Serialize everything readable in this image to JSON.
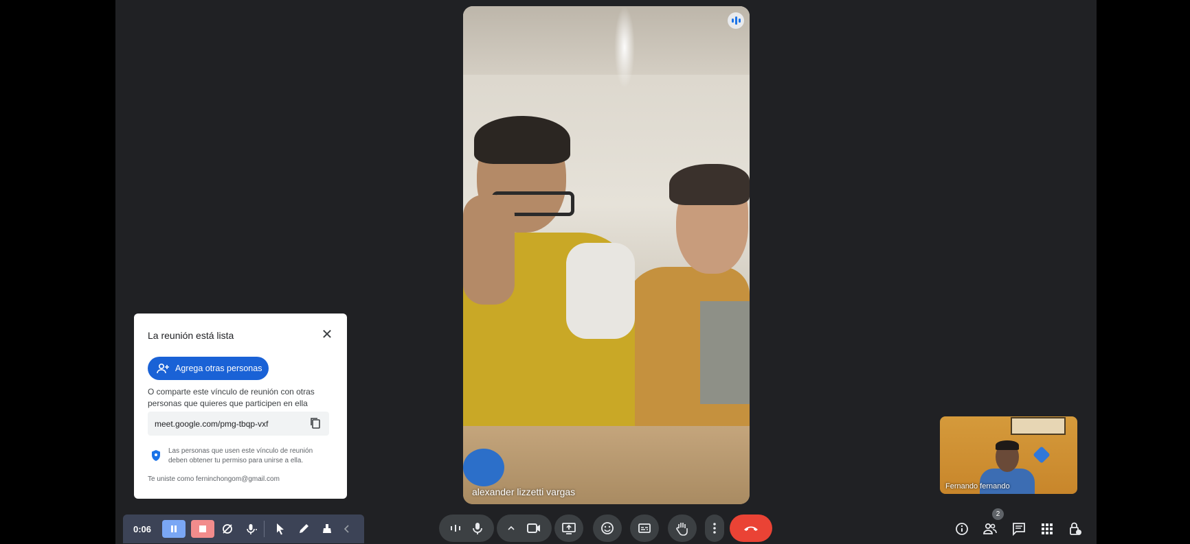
{
  "dialog": {
    "title": "La reunión está lista",
    "add_button_label": "Agrega otras personas",
    "share_text": "O comparte este vínculo de reunión con otras personas que quieres que participen en ella",
    "meeting_link": "meet.google.com/pmg-tbqp-vxf",
    "permission_text": "Las personas que usen este vínculo de reunión deben obtener tu permiso para unirse a ella.",
    "joined_as": "Te uniste como ferninchongom@gmail.com"
  },
  "main_participant": {
    "name": "alexander lizzetti vargas"
  },
  "self_participant": {
    "name": "Fernando fernando"
  },
  "recorder": {
    "timer": "0:06"
  },
  "people": {
    "count": "2"
  },
  "colors": {
    "end_call": "#ea4335",
    "primary_button": "#1a62d6",
    "recorder_bar": "#3c4356"
  },
  "icons": {
    "recorder": [
      "pause-icon",
      "stop-icon",
      "camera-off-icon",
      "mic-icon",
      "pointer-icon",
      "pen-icon",
      "eraser-icon",
      "collapse-chevron-icon"
    ],
    "controls": [
      "audio-levels-icon",
      "mic-icon",
      "chevron-up-icon",
      "camera-icon",
      "present-screen-icon",
      "emoji-icon",
      "captions-icon",
      "raise-hand-icon",
      "more-options-icon",
      "end-call-icon"
    ],
    "right": [
      "info-icon",
      "people-icon",
      "chat-icon",
      "activities-icon",
      "host-controls-icon"
    ]
  }
}
